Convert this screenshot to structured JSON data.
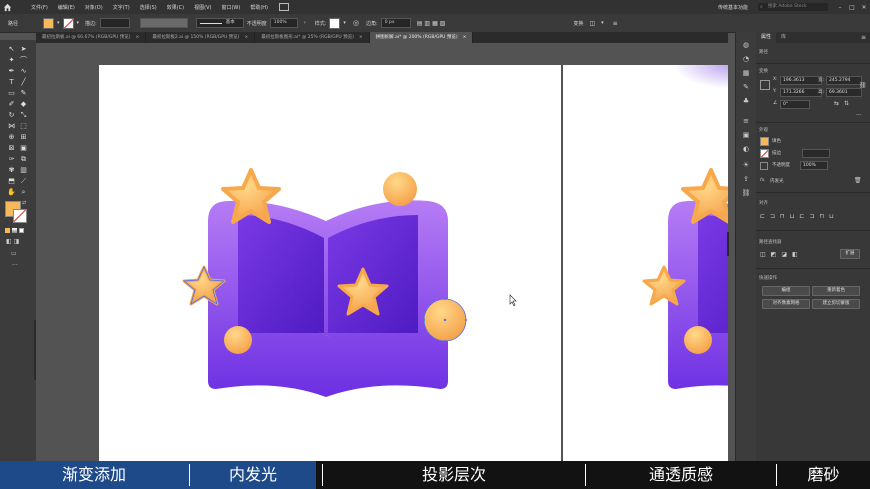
{
  "menubar": {
    "items": [
      "文件(F)",
      "编辑(E)",
      "对象(O)",
      "文字(T)",
      "选择(S)",
      "效果(C)",
      "视图(V)",
      "窗口(W)",
      "帮助(H)"
    ],
    "workspace": "传统基本功能",
    "search_placeholder": "搜索 Adobe Stock"
  },
  "controlbar": {
    "selection_label": "路径",
    "fill_color": "#F5B85A",
    "stroke_label": "描边:",
    "stroke_profile": "基本",
    "opacity_label": "不透明度",
    "opacity_value": "100%",
    "style_label": "样式:",
    "corner_label": "边角:",
    "corner_value": "0 px",
    "transform_label": "变换"
  },
  "tabs": [
    {
      "label": "最初拉斯板.ai @ 66.67% (RGB/GPU 预览)",
      "active": false
    },
    {
      "label": "最初拉斯板2.ai @ 150% (RGB/GPU 预览)",
      "active": false
    },
    {
      "label": "最初拉斯板图形.ai* @ 25% (RGB/GPU 预览)",
      "active": false
    },
    {
      "label": "拼图拆解.ai* @ 200% (RGB/GPU 预览)",
      "active": true
    }
  ],
  "properties_panel": {
    "tabs": [
      "属性",
      "库"
    ],
    "path_label": "路径",
    "transform_label": "变换",
    "x_label": "X:",
    "x_value": "196.3613",
    "y_label": "Y:",
    "y_value": "171.3266",
    "w_label": "宽:",
    "w_value": "245.2794",
    "h_label": "高:",
    "h_value": "69.3601",
    "angle_value": "0°",
    "appearance_label": "外观",
    "fill_label": "填色",
    "stroke_label": "描边",
    "opacity_label": "不透明度",
    "opacity_value": "100%",
    "fx_label": "内发光",
    "align_label": "对齐",
    "pathfinder_label": "路径查找器",
    "expand_label": "扩展",
    "quick_actions_label": "快速操作",
    "btn_edit": "编组",
    "btn_recolor": "重新着色",
    "btn_align_pixel": "对齐像素网格",
    "btn_recolor_art": "建立剪切蒙版"
  },
  "captions": [
    "渐变添加",
    "内发光",
    "投影层次",
    "通透质感",
    "磨砂"
  ],
  "colors": {
    "book_purple_light": "#A66BF2",
    "book_purple_dark": "#6A2BE0",
    "book_inner": "#5A22C8",
    "star_orange": "#F6A84B",
    "star_yellow": "#FFD27A",
    "selection_blue": "#4A6CF7"
  }
}
